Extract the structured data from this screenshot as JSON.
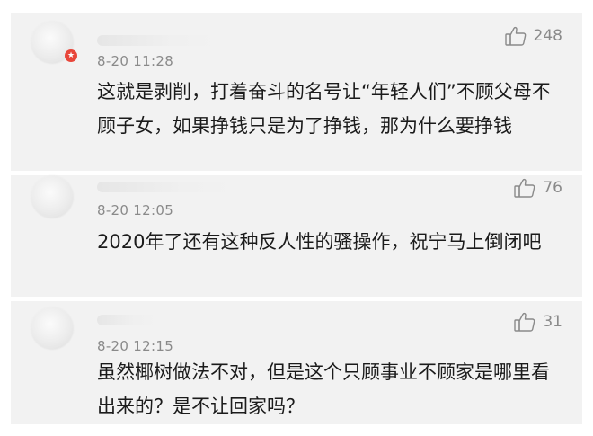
{
  "comments": [
    {
      "time": "8-20 11:28",
      "likes": "248",
      "text": "这就是剥削，打着奋斗的名号让“年轻人们”不顾父母不顾子女，如果挣钱只是为了挣钱，那为什么要挣钱",
      "has_badge": true
    },
    {
      "time": "8-20 12:05",
      "likes": "76",
      "text": "2020年了还有这种反人性的骚操作，祝宁马上倒闭吧"
    },
    {
      "time": "8-20 12:15",
      "likes": "31",
      "text": "虽然椰树做法不对，但是这个只顾事业不顾家是哪里看出来的？是不让回家吗？"
    }
  ],
  "icons": {
    "like": "thumbs-up-icon",
    "badge": "vip-badge-icon"
  },
  "colors": {
    "card_background": "#f2f2f2",
    "meta_text": "#8a8a8a",
    "body_text": "#1b1b1b",
    "badge": "#e8463a"
  }
}
